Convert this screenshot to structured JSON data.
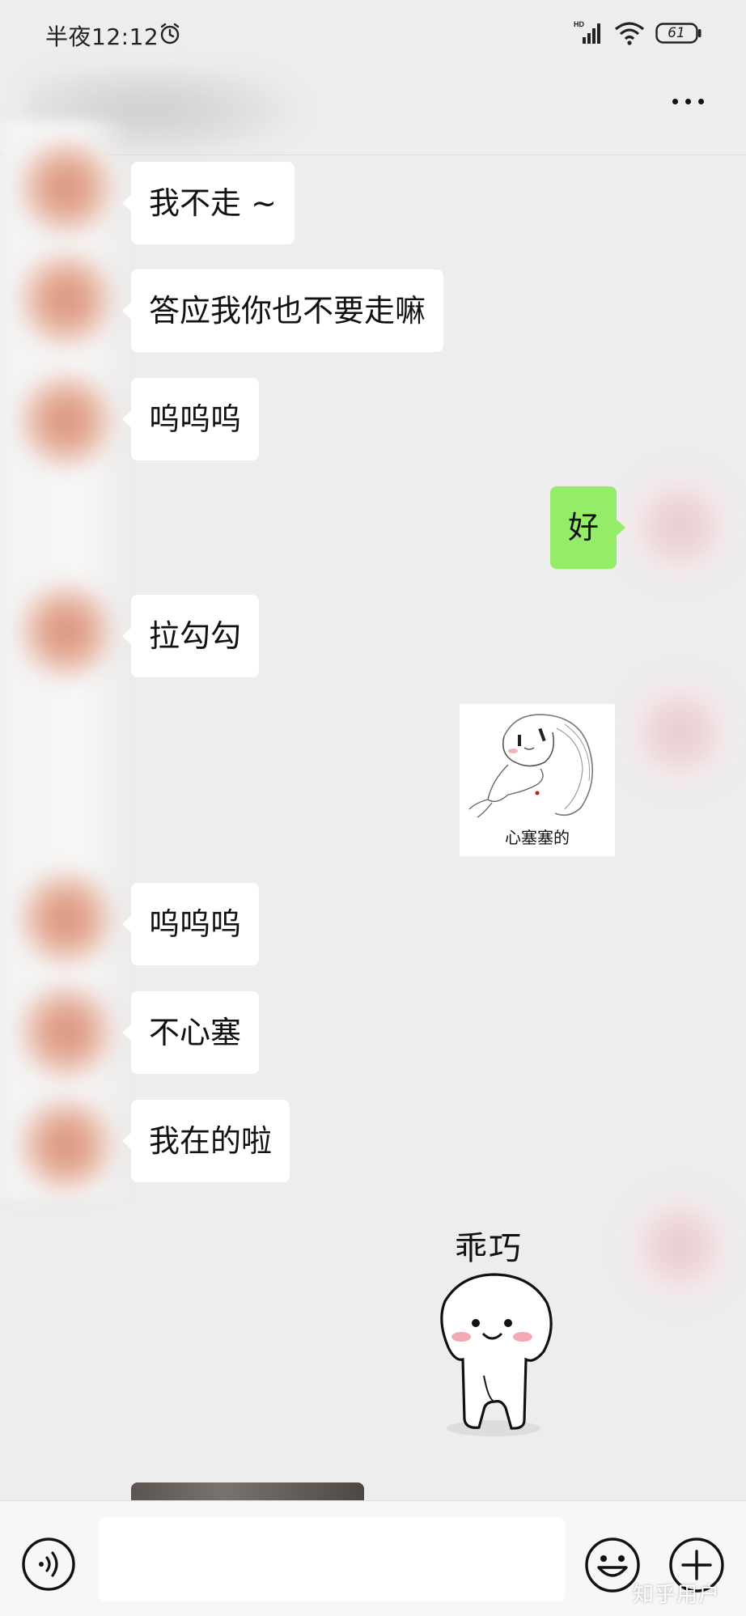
{
  "status_bar": {
    "time": "半夜12:12",
    "battery": "61",
    "network_badge": "HD"
  },
  "header": {
    "title": "",
    "more_icon": "more-dots-icon"
  },
  "messages": [
    {
      "side": "left",
      "text": "我不走 ~"
    },
    {
      "side": "left",
      "text": "答应我你也不要走嘛"
    },
    {
      "side": "left",
      "text": "呜呜呜"
    },
    {
      "side": "right",
      "text": "好"
    },
    {
      "side": "left",
      "text": "拉勾勾"
    },
    {
      "side": "right",
      "sticker": true,
      "caption": "心塞塞的"
    },
    {
      "side": "left",
      "text": "呜呜呜"
    },
    {
      "side": "left",
      "text": "不心塞"
    },
    {
      "side": "left",
      "text": "我在的啦"
    },
    {
      "side": "right",
      "sticker": true,
      "caption": "乖巧"
    },
    {
      "side": "left",
      "photo": true
    }
  ],
  "input_bar": {
    "voice_icon": "voice-icon",
    "emoji_icon": "emoji-icon",
    "plus_icon": "plus-icon",
    "placeholder": ""
  },
  "watermark": "知乎用户",
  "colors": {
    "background": "#ededed",
    "bubble_self": "#95ec69",
    "bubble_other": "#ffffff"
  }
}
